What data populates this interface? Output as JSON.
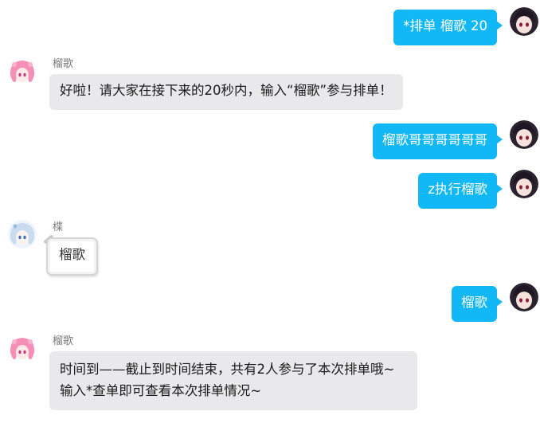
{
  "messages": [
    {
      "side": "right",
      "avatar": "dark-hair-girl-avatar",
      "text": "*排单 榴歌 20"
    },
    {
      "side": "left",
      "avatar": "pink-hair-girl-avatar",
      "sender": "榴歌",
      "text": "好啦！请大家在接下来的20秒内，输入“榴歌”参与排单！"
    },
    {
      "side": "right",
      "avatar": "dark-hair-girl-avatar",
      "text": "榴歌哥哥哥哥哥哥"
    },
    {
      "side": "right",
      "avatar": "dark-hair-girl-avatar",
      "text": "z执行榴歌"
    },
    {
      "side": "left",
      "avatar": "white-hair-girl-avatar",
      "sender": "楪",
      "text": "榴歌"
    },
    {
      "side": "right",
      "avatar": "dark-hair-girl-avatar",
      "text": "榴歌"
    },
    {
      "side": "left",
      "avatar": "pink-hair-girl-avatar",
      "sender": "榴歌",
      "lines": [
        "时间到——截止到时间结束，共有2人参与了本次排单哦~",
        "输入*查单即可查看本次排单情况~"
      ]
    }
  ],
  "colors": {
    "outgoing_bubble": "#12b7f5",
    "incoming_bubble": "#e9e9eb",
    "sender_name": "#7a7a7a"
  }
}
